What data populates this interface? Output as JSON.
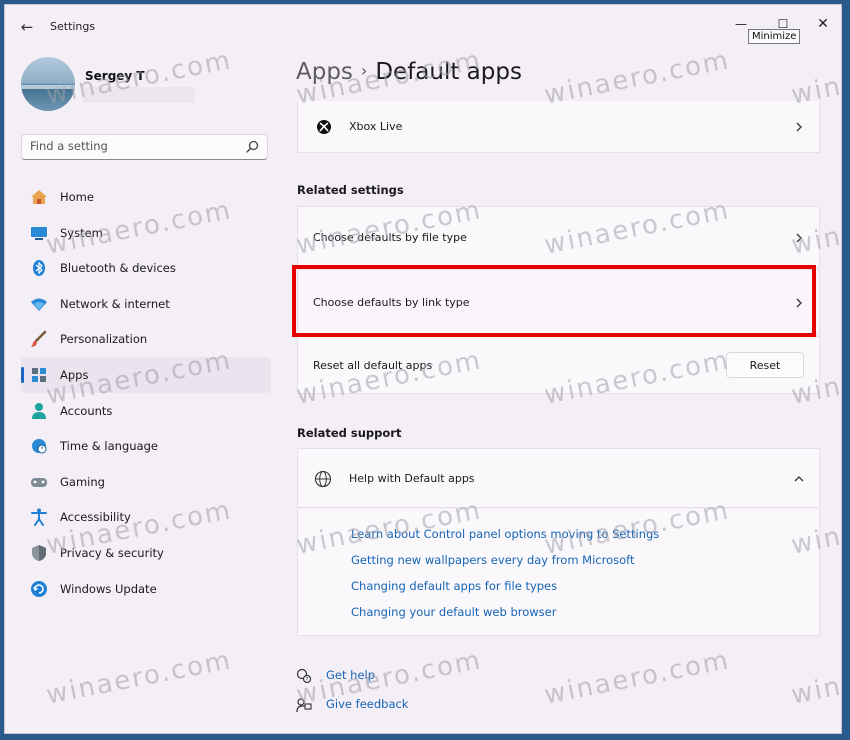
{
  "window": {
    "app_title": "Settings",
    "tooltip": "Minimize",
    "controls": {
      "minimize": "—",
      "maximize": "☐",
      "close": "✕"
    }
  },
  "user": {
    "name": "Sergey T"
  },
  "search": {
    "placeholder": "Find a setting"
  },
  "nav": {
    "active": "Apps",
    "items": [
      {
        "label": "Home",
        "icon": "home-icon"
      },
      {
        "label": "System",
        "icon": "system-icon"
      },
      {
        "label": "Bluetooth & devices",
        "icon": "bluetooth-icon"
      },
      {
        "label": "Network & internet",
        "icon": "wifi-icon"
      },
      {
        "label": "Personalization",
        "icon": "brush-icon"
      },
      {
        "label": "Apps",
        "icon": "apps-icon"
      },
      {
        "label": "Accounts",
        "icon": "accounts-icon"
      },
      {
        "label": "Time & language",
        "icon": "globe-clock-icon"
      },
      {
        "label": "Gaming",
        "icon": "gamepad-icon"
      },
      {
        "label": "Accessibility",
        "icon": "accessibility-icon"
      },
      {
        "label": "Privacy & security",
        "icon": "shield-icon"
      },
      {
        "label": "Windows Update",
        "icon": "update-icon"
      }
    ]
  },
  "breadcrumb": {
    "parent": "Apps",
    "separator": "›",
    "current": "Default apps"
  },
  "xbox_row": {
    "label": "Xbox Live"
  },
  "related_settings": {
    "title": "Related settings",
    "file_type": "Choose defaults by file type",
    "link_type": "Choose defaults by link type",
    "reset_label": "Reset all default apps",
    "reset_button": "Reset"
  },
  "related_support": {
    "title": "Related support",
    "help_label": "Help with Default apps",
    "links": [
      "Learn about Control panel options moving to Settings",
      "Getting new wallpapers every day from Microsoft",
      "Changing default apps for file types",
      "Changing your default web browser"
    ]
  },
  "footer": {
    "get_help": "Get help",
    "give_feedback": "Give feedback"
  },
  "watermark": "winaero.com",
  "colors": {
    "accent": "#1766c2",
    "link": "#1565b5",
    "highlight": "#e60000"
  }
}
